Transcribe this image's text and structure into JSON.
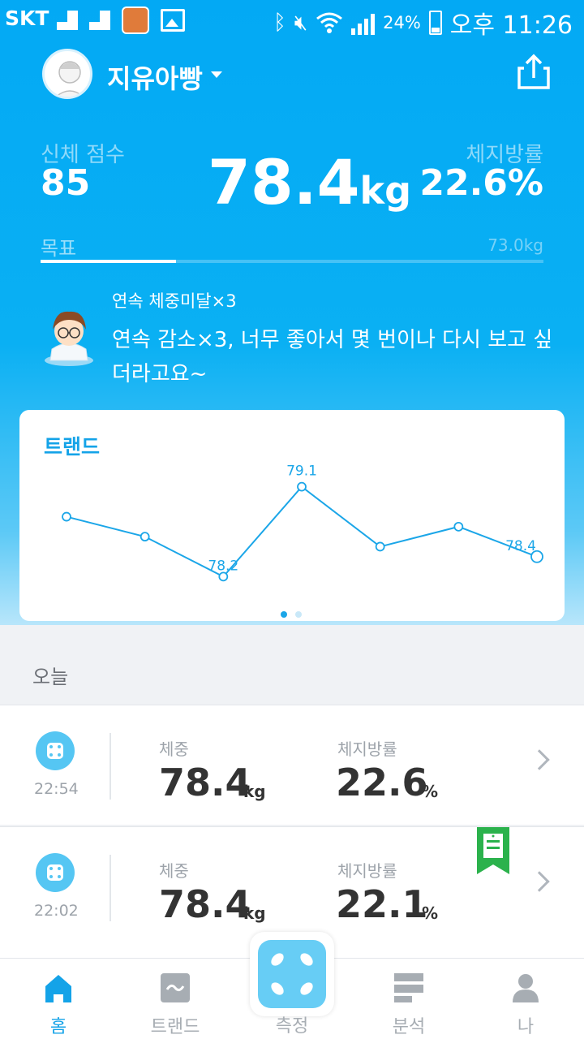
{
  "statusbar": {
    "carrier": "SKT",
    "battery": "24%",
    "time": "오후 11:26"
  },
  "profile": {
    "name": "지유아빵"
  },
  "stats": {
    "score_label": "신체 점수",
    "score_value": "85",
    "weight_value": "78.4",
    "weight_unit": "kg",
    "fat_label": "체지방률",
    "fat_value": "22.6%"
  },
  "goal": {
    "label": "목표",
    "value": "73.0kg",
    "progress_fraction": 0.27
  },
  "medal": {
    "title": "연속 체중미달×3",
    "message": "연속 감소×3, 너무 좋아서 몇 번이나 다시 보고 싶더라고요~"
  },
  "trend": {
    "title": "트랜드",
    "page_index": 0,
    "page_count": 2,
    "colors": {
      "line": "#1ba6e8",
      "dot_active": "#1ba6e8",
      "dot_inactive": "#c9e8f8"
    }
  },
  "chart_data": {
    "type": "line",
    "x": [
      1,
      2,
      3,
      4,
      5,
      6,
      7
    ],
    "values": [
      78.8,
      78.6,
      78.2,
      79.1,
      78.5,
      78.7,
      78.4
    ],
    "labels": [
      "",
      "",
      "78.2",
      "79.1",
      "",
      "",
      "78.4"
    ],
    "title": "트랜드",
    "ylim": [
      78.0,
      79.3
    ],
    "grid": false
  },
  "today": {
    "label": "오늘"
  },
  "records": [
    {
      "time": "22:54",
      "weight_label": "체중",
      "weight_value": "78.4",
      "weight_unit": "kg",
      "fat_label": "체지방률",
      "fat_value": "22.6",
      "fat_unit": "%"
    },
    {
      "time": "22:02",
      "weight_label": "체중",
      "weight_value": "78.4",
      "weight_unit": "kg",
      "fat_label": "체지방률",
      "fat_value": "22.1",
      "fat_unit": "%"
    }
  ],
  "nav": {
    "home": "홈",
    "trend": "트랜드",
    "measure": "측정",
    "analysis": "분석",
    "me": "나"
  },
  "colors": {
    "accent": "#03a9f4",
    "active_nav": "#14a3e8",
    "inactive_nav": "#a7adb3",
    "badge_green": "#2bb24c"
  }
}
